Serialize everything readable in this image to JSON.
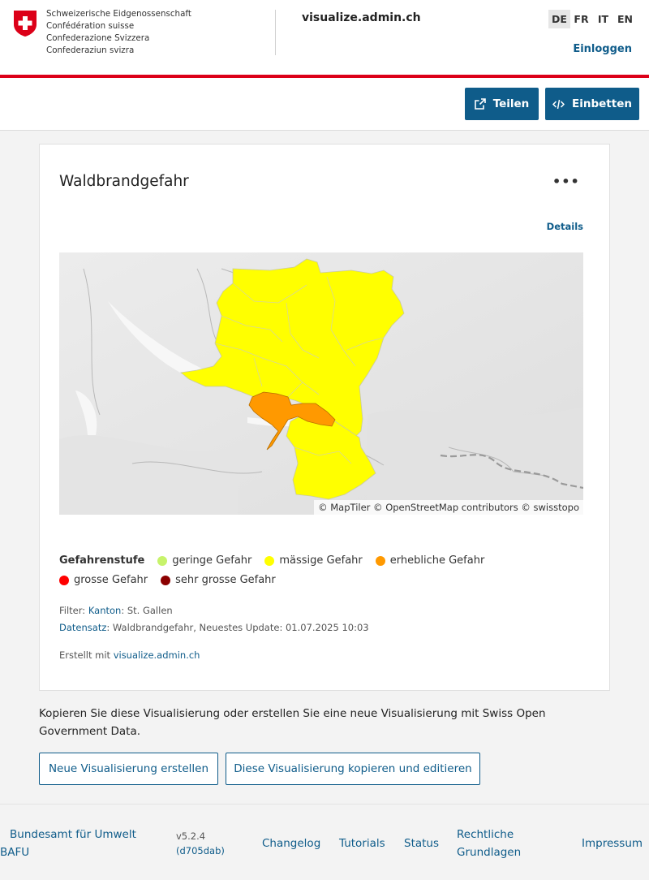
{
  "header": {
    "confederation_lines": [
      "Schweizerische Eidgenossenschaft",
      "Confédération suisse",
      "Confederazione Svizzera",
      "Confederaziun svizra"
    ],
    "site_title": "visualize.admin.ch",
    "languages": [
      "DE",
      "FR",
      "IT",
      "EN"
    ],
    "active_language": "DE",
    "login_label": "Einloggen"
  },
  "toolbar": {
    "share_label": "Teilen",
    "embed_label": "Einbetten"
  },
  "card": {
    "title": "Waldbrandgefahr",
    "more_label": "•••",
    "details_label": "Details",
    "map_attribution": "© MapTiler © OpenStreetMap contributors © swisstopo",
    "legend_title": "Gefahrenstufe",
    "legend": [
      {
        "label": "geringe Gefahr",
        "color": "#c7f36b"
      },
      {
        "label": "mässige Gefahr",
        "color": "#ffff00"
      },
      {
        "label": "erhebliche Gefahr",
        "color": "#ff9900"
      },
      {
        "label": "grosse Gefahr",
        "color": "#ff0000"
      },
      {
        "label": "sehr grosse Gefahr",
        "color": "#8b0000"
      }
    ],
    "filter_prefix": "Filter:",
    "filter_key": "Kanton",
    "filter_value": ": St. Gallen",
    "dataset_key": "Datensatz",
    "dataset_value": ": Waldbrandgefahr, Neuestes Update: 01.07.2025 10:03",
    "created_prefix": "Erstellt mit",
    "created_link": "visualize.admin.ch"
  },
  "cta": {
    "text": "Kopieren Sie diese Visualisierung oder erstellen Sie eine neue Visualisierung mit Swiss Open Government Data.",
    "new_label": "Neue Visualisierung erstellen",
    "copy_label": "Diese Visualisierung kopieren und editieren"
  },
  "footer": {
    "org_line1": "Bundesamt für Umwelt",
    "org_line2": "BAFU",
    "version": "v5.2.4",
    "commit": "(d705dab)",
    "changelog": "Changelog",
    "tutorials": "Tutorials",
    "status": "Status",
    "legal_line1": "Rechtliche",
    "legal_line2": "Grundlagen",
    "imprint": "Impressum"
  },
  "colors": {
    "accent": "#0f5c8a",
    "brand_red": "#dc0018",
    "danger_moderate": "#ffff00",
    "danger_considerable": "#ff9900"
  }
}
